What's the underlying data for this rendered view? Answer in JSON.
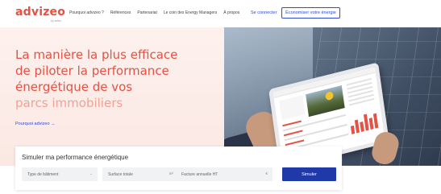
{
  "header": {
    "logo": "advizeo",
    "logo_sub": "by setec",
    "nav": [
      {
        "label": "Pourquoi advizeo ?"
      },
      {
        "label": "Références"
      },
      {
        "label": "Partenariat"
      },
      {
        "label": "Le coin des Energy Managers"
      },
      {
        "label": "À propos"
      }
    ],
    "login_label": "Se connecter",
    "cta_label": "Économiser votre énergie"
  },
  "hero": {
    "headline_lines": [
      "La manière la plus efficace",
      "de piloter la performance",
      "énergétique de vos",
      "parcs immobiliers"
    ],
    "link_label": "Pourquoi advizeo",
    "link_arrow": "→"
  },
  "simulator": {
    "title": "Simuler ma performance énergétique",
    "building_type": {
      "placeholder": "Type de bâtiment",
      "icon": "chevron-down-icon"
    },
    "surface": {
      "placeholder": "Surface totale",
      "unit": "m²"
    },
    "invoice": {
      "placeholder": "Facture annuelle HT",
      "unit": "€"
    },
    "submit_label": "Simuler"
  },
  "colors": {
    "brand": "#e35244",
    "brand_light": "#f0a296",
    "accent": "#2d4ad6",
    "button": "#1f3aa8",
    "hero_bg": "#fdf1ee"
  }
}
